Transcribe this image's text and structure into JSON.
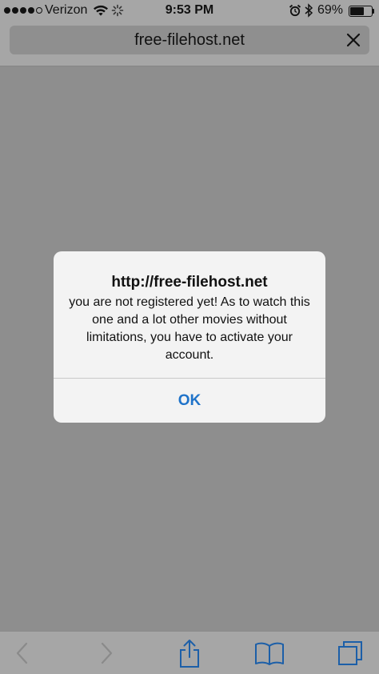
{
  "status_bar": {
    "carrier": "Verizon",
    "time": "9:53 PM",
    "battery_percent": "69%",
    "battery_level": 0.69,
    "signal_bars_filled": 4,
    "signal_bars_total": 5
  },
  "address_bar": {
    "url": "free-filehost.net"
  },
  "dialog": {
    "title": "http://free-filehost.net",
    "message": "you are not registered yet! As to watch this one and a lot other movies without limitations, you have to activate your account.",
    "ok_label": "OK"
  },
  "toolbar": {
    "icons": [
      "back-icon",
      "forward-icon",
      "share-icon",
      "bookmarks-icon",
      "tabs-icon"
    ]
  },
  "colors": {
    "accent": "#1f73c9",
    "overlay": "#8e8e8e",
    "chrome": "#a6a6a6"
  }
}
